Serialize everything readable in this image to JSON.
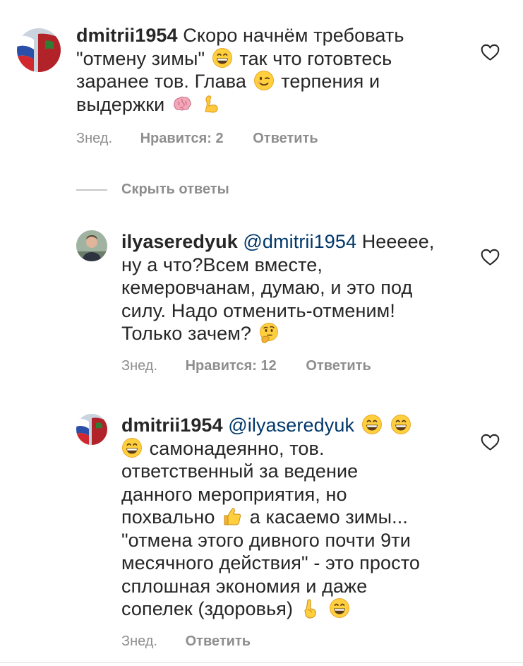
{
  "comments": [
    {
      "username": "dmitrii1954",
      "mention": "",
      "text": [
        "Скоро начнём требовать",
        "\"отмену зимы\"",
        " так что готовтесь",
        "заранее тов. Глава",
        " терпения и",
        "выдержки"
      ],
      "time": "Знед.",
      "likes": "Нравится: 2",
      "reply": "Ответить"
    },
    {
      "username": "ilyaseredyuk",
      "mention": "@dmitrii1954",
      "text": [
        "Нееeee,",
        "ну а что?Всем вместе,",
        "кемеровчанам, думаю, и это под",
        "силу. Надо отменить-отменим!",
        "Только зачем?"
      ],
      "time": "Знед.",
      "likes": "Нравится: 12",
      "reply": "Ответить"
    },
    {
      "username": "dmitrii1954",
      "mention": "@ilyaseredyuk",
      "text": [
        "самонадеянно, тов.",
        "ответственный за ведение",
        "данного мероприятия, но",
        "похвально",
        " а касаемо зимы...",
        "\"отмена этого дивного почти 9ти",
        "месячного действия\" - это просто",
        "сплошная экономия и даже",
        "сопелек (здоровья)"
      ],
      "time": "Знед.",
      "likes": "",
      "reply": "Ответить"
    }
  ],
  "hide_replies": "Скрыть ответы",
  "icons": {
    "like": "heart-outline-icon",
    "grin": "grinning-face-icon",
    "wink": "winking-face-icon",
    "brain": "brain-icon",
    "muscle": "flexed-biceps-icon",
    "thinking": "thinking-face-icon",
    "thumbs": "thumbs-up-icon",
    "finger": "index-pointing-up-icon"
  },
  "colors": {
    "text": "#262626",
    "secondary": "#8e8e8e",
    "mention": "#00376b"
  }
}
